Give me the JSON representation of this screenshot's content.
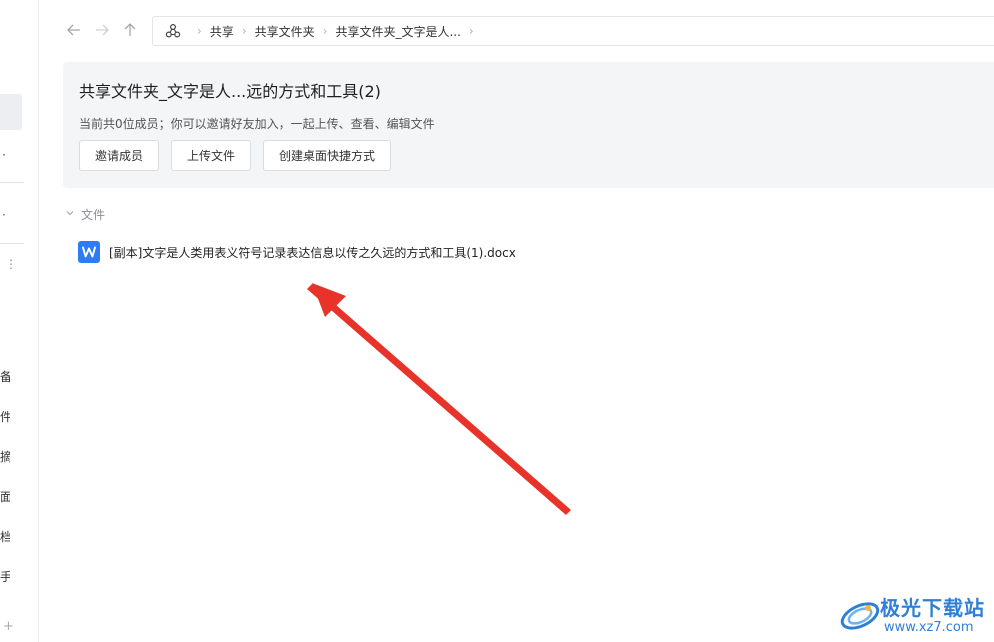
{
  "nav": {
    "back_icon": "arrow-left-icon",
    "forward_icon": "arrow-right-icon",
    "up_icon": "arrow-up-icon"
  },
  "breadcrumb": {
    "root_icon": "share-network-icon",
    "items": [
      "共享",
      "共享文件夹",
      "共享文件夹_文字是人..."
    ]
  },
  "header": {
    "title": "共享文件夹_文字是人...远的方式和工具(2)",
    "member_info": "当前共0位成员；你可以邀请好友加入，一起上传、查看、编辑文件",
    "buttons": {
      "invite": "邀请成员",
      "upload": "上传文件",
      "shortcut": "创建桌面快捷方式"
    }
  },
  "files_section": {
    "label": "文件",
    "files": [
      {
        "name": "[副本]文字是人类用表义符号记录表达信息以传之久远的方式和工具(1).docx",
        "icon": "wps-writer-icon"
      }
    ]
  },
  "sidebar": {
    "cropped_labels": [
      "备",
      "件",
      "摘",
      "面",
      "档",
      "手"
    ]
  },
  "watermark": {
    "brand": "极光下载站",
    "url": "www.xz7.com"
  },
  "colors": {
    "accent": "#2d7cf6",
    "annotation_arrow": "#e8332a",
    "header_bg": "#f4f5f7"
  }
}
